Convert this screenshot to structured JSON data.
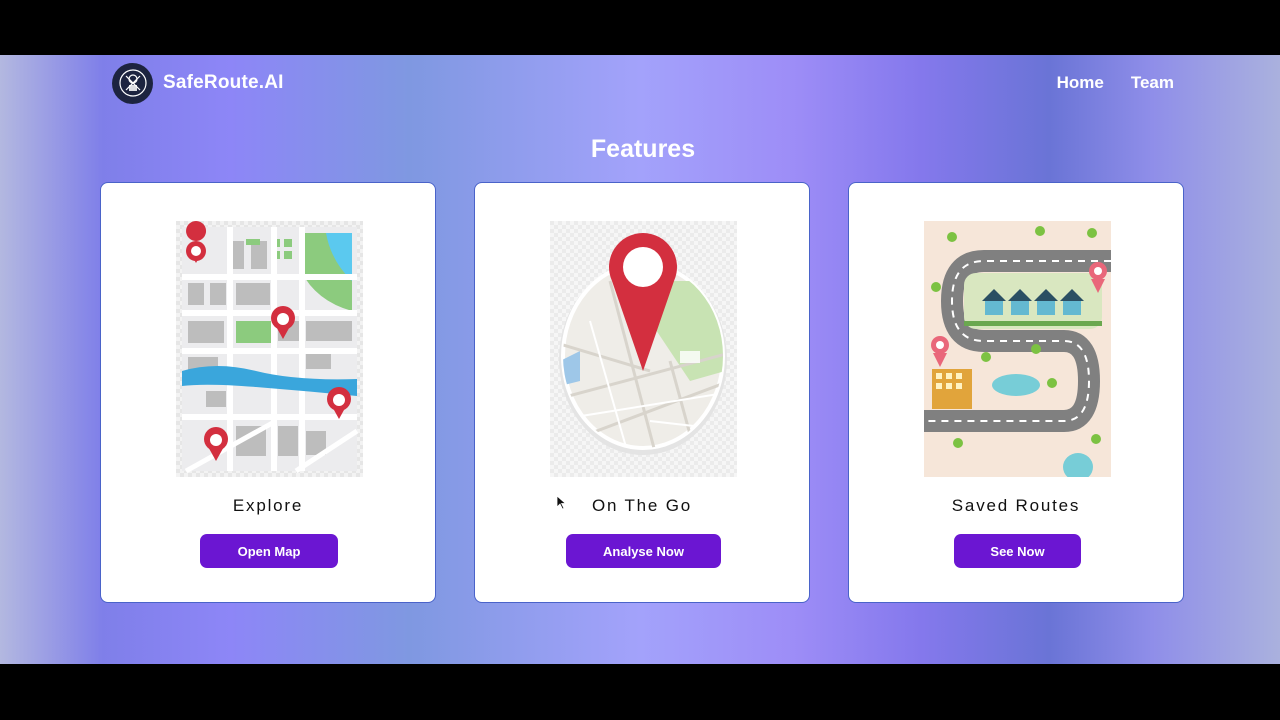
{
  "navbar": {
    "brand": "SafeRoute.AI",
    "links": [
      "Home",
      "Team"
    ]
  },
  "features": {
    "title": "Features",
    "cards": [
      {
        "title": "Explore",
        "button": "Open Map",
        "image": "city-map-with-pins"
      },
      {
        "title": "On The Go",
        "button": "Analyse Now",
        "image": "location-pin-on-globe"
      },
      {
        "title": "Saved Routes",
        "button": "See Now",
        "image": "winding-road-map"
      }
    ]
  },
  "colors": {
    "button": "#6b16d2",
    "pin": "#d32f3f",
    "card_border": "#4a63c9",
    "logo_bg": "#1d2440"
  }
}
